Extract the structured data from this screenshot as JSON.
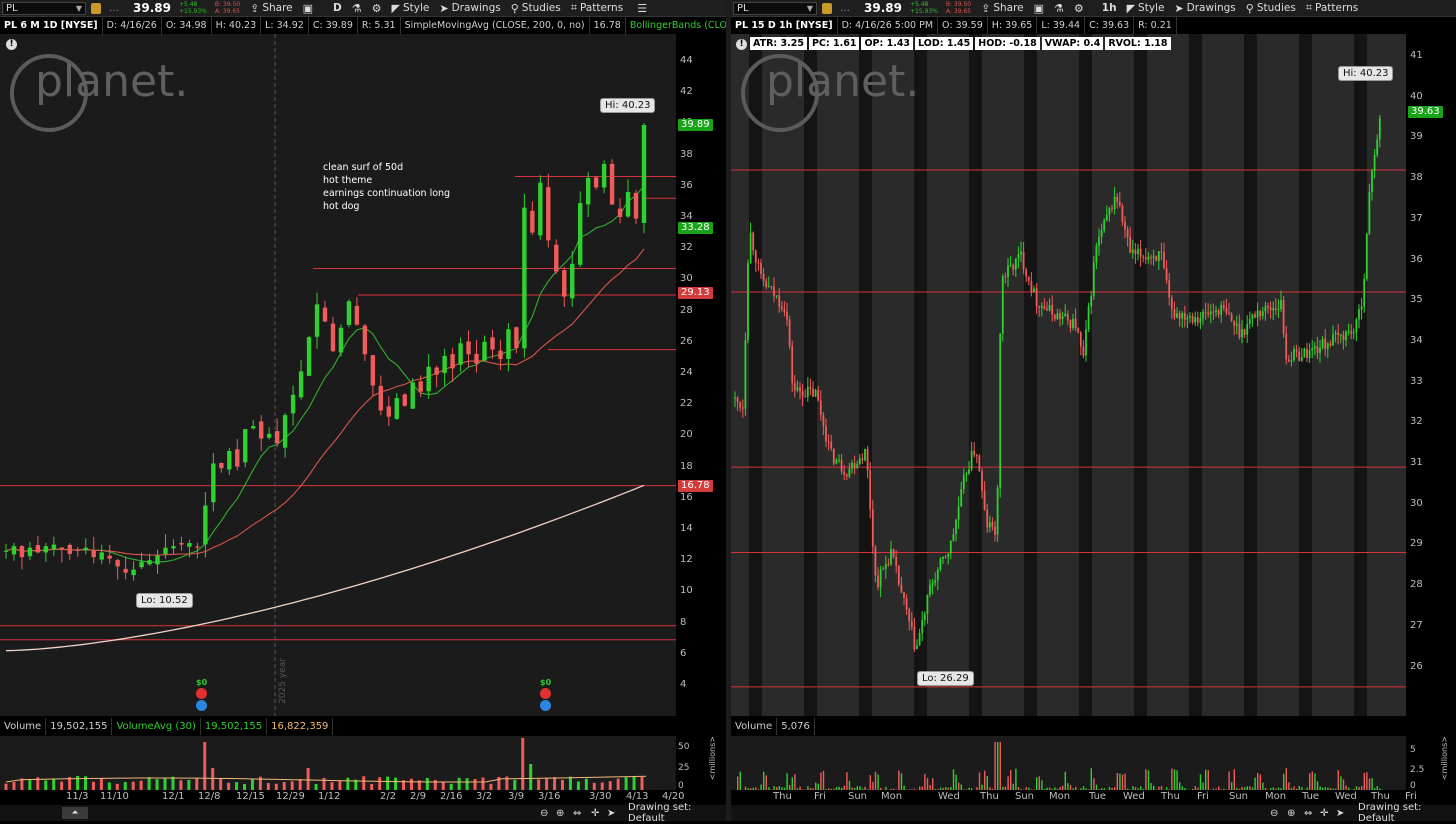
{
  "left": {
    "symbol": "PL",
    "last": "39.89",
    "change": "+5.48",
    "change_pct": "+15.93%",
    "bid": "B: 39.50",
    "ask": "A: 39.65",
    "timeframe": "D",
    "toolbar": {
      "share": "Share",
      "style": "Style",
      "drawings": "Drawings",
      "studies": "Studies",
      "patterns": "Patterns"
    },
    "info": {
      "title": "PL 6 M 1D [NYSE]",
      "date": "D: 4/16/26",
      "open": "O: 34.98",
      "high": "H: 40.23",
      "low": "L: 34.92",
      "close": "C: 39.89",
      "range": "R: 5.31",
      "sma": "SimpleMovingAvg (CLOSE, 200, 0, no)",
      "sma_val": "16.78",
      "bb": "BollingerBands (CLOSE,..."
    },
    "price_ticks": [
      "44",
      "42",
      "40",
      "38",
      "36",
      "34",
      "32",
      "30",
      "28",
      "26",
      "24",
      "22",
      "20",
      "18",
      "16",
      "14",
      "12",
      "10",
      "8",
      "6",
      "4"
    ],
    "tags": [
      {
        "label": "39.89",
        "color": "#19a319",
        "price": 39.89
      },
      {
        "label": "33.28",
        "color": "#19a319",
        "price": 33.28
      },
      {
        "label": "29.13",
        "color": "#d43c3c",
        "price": 29.13
      },
      {
        "label": "16.78",
        "color": "#d43c3c",
        "price": 16.78
      }
    ],
    "callouts": {
      "hi": "Hi: 40.23",
      "lo": "Lo: 10.52"
    },
    "notes": [
      "clean surf of 50d",
      "hot theme",
      "earnings continuation long",
      "hot dog"
    ],
    "year_label": "2025 year",
    "div_label": "$0",
    "volume": {
      "label": "Volume",
      "value": "19,502,155",
      "avg_label": "VolumeAvg (30)",
      "avg_value": "19,502,155",
      "avg2": "16,822,359",
      "ticks": [
        "50",
        "25",
        "0"
      ],
      "unit": "<millions>"
    },
    "time_labels": [
      "11/3",
      "11/10",
      "12/1",
      "12/8",
      "12/15",
      "12/29",
      "1/12",
      "2/2",
      "2/9",
      "2/16",
      "3/2",
      "3/9",
      "3/16",
      "3/30",
      "4/13",
      "4/20"
    ],
    "drawing_set": "Drawing set: Default"
  },
  "right": {
    "symbol": "PL",
    "last": "39.89",
    "change": "+5.48",
    "change_pct": "+15.93%",
    "bid": "B: 39.50",
    "ask": "A: 39.65",
    "timeframe": "1h",
    "toolbar": {
      "share": "Share",
      "style": "Style",
      "drawings": "Drawings",
      "studies": "Studies",
      "patterns": "Patterns"
    },
    "info": {
      "title": "PL 15 D 1h [NYSE]",
      "date": "D: 4/16/26 5:00 PM",
      "open": "O: 39.59",
      "high": "H: 39.65",
      "low": "L: 39.44",
      "close": "C: 39.63",
      "range": "R: 0.21"
    },
    "study_boxes": [
      "ATR: 3.25",
      "PC: 1.61",
      "OP: 1.43",
      "LOD: 1.45",
      "HOD: -0.18",
      "VWAP: 0.4",
      "RVOL: 1.18"
    ],
    "price_ticks": [
      "41",
      "40",
      "39",
      "38",
      "37",
      "36",
      "35",
      "34",
      "33",
      "32",
      "31",
      "30",
      "29",
      "28",
      "27",
      "26"
    ],
    "tags": [
      {
        "label": "39.63",
        "color": "#19a319",
        "price": 39.63
      }
    ],
    "callouts": {
      "hi": "Hi: 40.23",
      "lo": "Lo: 26.29"
    },
    "volume": {
      "label": "Volume",
      "value": "5,076",
      "ticks": [
        "5",
        "2.5",
        "0"
      ],
      "unit": "<millions>"
    },
    "time_labels": [
      "Thu",
      "Fri",
      "Sun",
      "Mon",
      "Wed",
      "Thu",
      "Sun",
      "Mon",
      "Tue",
      "Wed",
      "Thu",
      "Fri",
      "Sun",
      "Mon",
      "Tue",
      "Wed",
      "Thu",
      "Fri"
    ],
    "drawing_set": "Drawing set: Default"
  },
  "logo_text": "planet.",
  "colors": {
    "up": "#2ed12e",
    "down": "#f05b5b",
    "level": "#d8323c",
    "ma50": "#d8564a",
    "ma20": "#2fae2f",
    "ma200": "#f2d3c6"
  }
}
